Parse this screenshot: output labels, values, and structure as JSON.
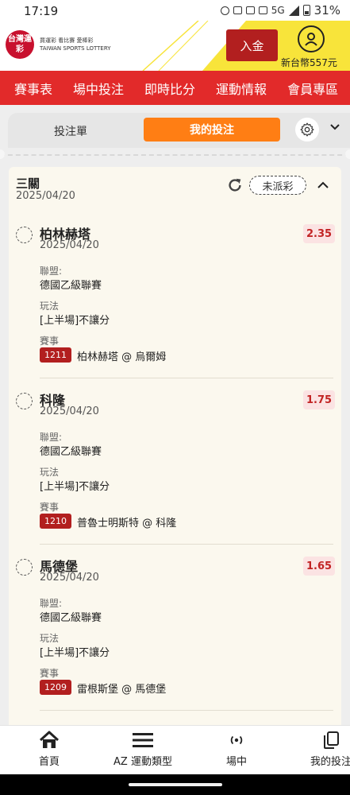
{
  "status_bar": {
    "time": "17:19",
    "network": "5G",
    "battery": "31%"
  },
  "header": {
    "logo_text": "台灣運彩",
    "logo_sub_cn": "買運彩 看比賽 愛棒彩",
    "logo_sub_en": "TAIWAN SPORTS LOTTERY",
    "deposit_label": "入金",
    "balance": "新台幣557元"
  },
  "nav": {
    "items": [
      "賽事表",
      "場中投注",
      "即時比分",
      "運動情報",
      "會員專區"
    ]
  },
  "tabs": {
    "slip": "投注單",
    "mine": "我的投注"
  },
  "ticket": {
    "title": "三關",
    "date": "2025/04/20",
    "status": "未派彩"
  },
  "bets": [
    {
      "team": "柏林赫塔",
      "date": "2025/04/20",
      "odds": "2.35",
      "league_label": "聯盟:",
      "league": "德國乙級聯賽",
      "play_label": "玩法",
      "play": "[上半場]不讓分",
      "match_label": "賽事",
      "match_code": "1211",
      "match": "柏林赫塔 @ 烏爾姆"
    },
    {
      "team": "科隆",
      "date": "2025/04/20",
      "odds": "1.75",
      "league_label": "聯盟:",
      "league": "德國乙級聯賽",
      "play_label": "玩法",
      "play": "[上半場]不讓分",
      "match_label": "賽事",
      "match_code": "1210",
      "match": "普魯士明斯特 @ 科隆"
    },
    {
      "team": "馬德堡",
      "date": "2025/04/20",
      "odds": "1.65",
      "league_label": "聯盟:",
      "league": "德國乙級聯賽",
      "play_label": "玩法",
      "play": "[上半場]不讓分",
      "match_label": "賽事",
      "match_code": "1209",
      "match": "雷根斯堡 @ 馬德堡"
    }
  ],
  "bottom_nav": {
    "home": "首頁",
    "sports": "AZ 運動類型",
    "live": "場中",
    "mybets": "我的投注"
  },
  "colors": {
    "brand_red": "#e22a2a",
    "accent_orange": "#ff7e14",
    "accent_yellow": "#f8e43a",
    "odds_red": "#c22424"
  }
}
